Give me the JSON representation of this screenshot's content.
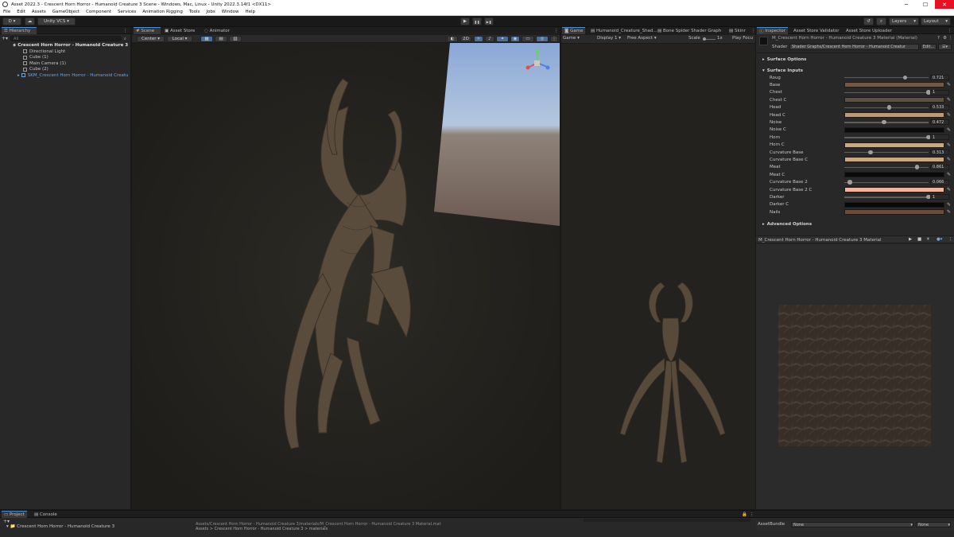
{
  "window": {
    "title": "Asset 2022.3 - Crescent Horn Horror - Humanoid Creature 3 Scene - Windows, Mac, Linux - Unity 2022.3.14f1 <DX11>",
    "minimize": "─",
    "maximize": "☐",
    "close": "✕"
  },
  "menu": [
    "File",
    "Edit",
    "Assets",
    "GameObject",
    "Component",
    "Services",
    "Animation Rigging",
    "Tools",
    "Jobs",
    "Window",
    "Help"
  ],
  "toolbar": {
    "account": "D",
    "cloud": "☁",
    "vcs": "Unity VCS",
    "play": "▶",
    "pause": "❚❚",
    "step": "▶❚",
    "history": "↺",
    "search": "⌕",
    "layers": "Layers",
    "layout": "Layout"
  },
  "hierarchy": {
    "tab": "Hierarchy",
    "search_placeholder": "All",
    "scene": "Crescent Horn Horror - Humanoid Creature 3",
    "items": [
      "Directional Light",
      "Cube (1)",
      "Main Camera (1)",
      "Cube (2)",
      "SKM_Crescent Horn Horror - Humanoid Creatu"
    ]
  },
  "scene_tabs": [
    "Scene",
    "Asset Store",
    "Animator"
  ],
  "scene_toolbar": {
    "pivot": "Center",
    "space": "Local",
    "mode_2d": "2D"
  },
  "game_tabs": [
    "Game",
    "Humanoid_Creature_Shad...",
    "Bone Spider Shader Graph",
    "Skinr"
  ],
  "game_toolbar": {
    "view": "Game",
    "display": "Display 1",
    "aspect": "Free Aspect",
    "scale_label": "Scale",
    "scale_value": "1x",
    "play_focus": "Play Focu"
  },
  "inspector": {
    "tabs": [
      "Inspector",
      "Asset Store Validator",
      "Asset Store Uploader"
    ],
    "material_name": "M_Crescent Horn Horror - Humanoid Creature 3 Material (Material)",
    "shader_label": "Shader",
    "shader_value": "Shader Graphs/Crescent Horn Horror - Humanoid Creatur",
    "edit_button": "Edit...",
    "surface_options": "Surface Options",
    "surface_inputs": "Surface Inputs",
    "advanced_options": "Advanced Options",
    "properties": [
      {
        "label": "Roug",
        "type": "slider",
        "value": "0.721",
        "fraction": 0.721
      },
      {
        "label": "Base",
        "type": "color",
        "color": "#745a44"
      },
      {
        "label": "Chest",
        "type": "slider",
        "value": "1",
        "fraction": 1.0
      },
      {
        "label": "Chest C",
        "type": "color",
        "color": "#5f5140"
      },
      {
        "label": "Head",
        "type": "slider",
        "value": "0.533",
        "fraction": 0.533
      },
      {
        "label": "Head C",
        "type": "color",
        "color": "#b89a7a"
      },
      {
        "label": "Noise",
        "type": "slider",
        "value": "0.472",
        "fraction": 0.472
      },
      {
        "label": "Noise C",
        "type": "color",
        "color": "#0b0b0b"
      },
      {
        "label": "Horn",
        "type": "slider",
        "value": "1",
        "fraction": 1.0
      },
      {
        "label": "Horn C",
        "type": "color",
        "color": "#c8aa85"
      },
      {
        "label": "Curvature Base",
        "type": "slider",
        "value": "0.313",
        "fraction": 0.313
      },
      {
        "label": "Curvature Base C",
        "type": "color",
        "color": "#c9a780"
      },
      {
        "label": "Meat",
        "type": "slider",
        "value": "0.861",
        "fraction": 0.861
      },
      {
        "label": "Meat C",
        "type": "color",
        "color": "#0a0a0a"
      },
      {
        "label": "Curvature Base 2",
        "type": "slider",
        "value": "0.066",
        "fraction": 0.066
      },
      {
        "label": "Curvature Base 2 C",
        "type": "color",
        "color": "#f0b59c"
      },
      {
        "label": "Darker",
        "type": "slider",
        "value": "1",
        "fraction": 1.0
      },
      {
        "label": "Darker C",
        "type": "color",
        "color": "#080808"
      },
      {
        "label": "Nails",
        "type": "color",
        "color": "#6a4c3a"
      }
    ],
    "preview_title": "M_Crescent Horn Horror - Humanoid Creature 3 Material",
    "asset_bundle_label": "AssetBundle",
    "asset_bundle_value": "None",
    "asset_bundle_variant": "None"
  },
  "bottom": {
    "tabs": [
      "Project",
      "Console"
    ],
    "project_item": "Crescent Horn Horror - Humanoid Creature 3",
    "path_top": "Assets/Crescent Horn Horror - Humanoid Creature 3/materials/M_Crescent Horn Horror - Humanoid Creature 3 Material.mat",
    "path_bottom": "Assets > Crescent Horn Horror - Humanoid Creature 3 > materials"
  }
}
